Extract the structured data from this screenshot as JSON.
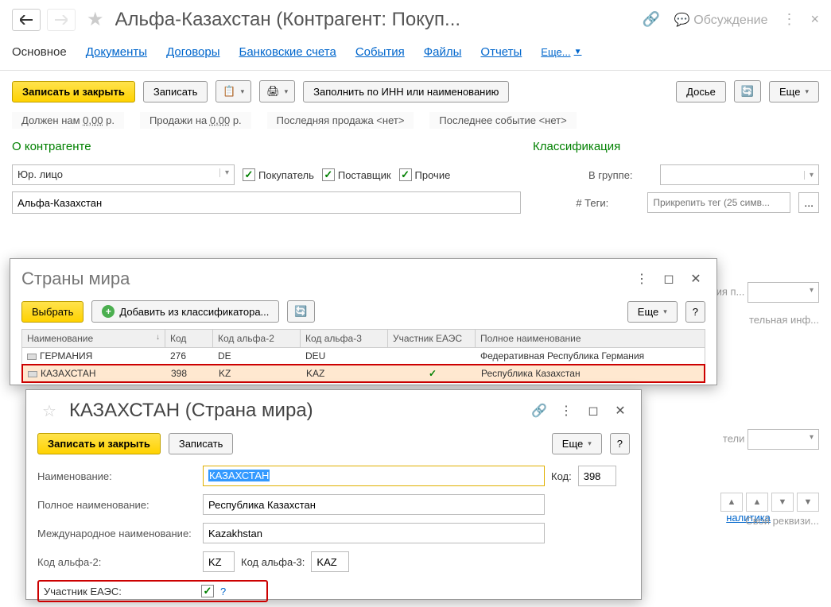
{
  "header": {
    "title": "Альфа-Казахстан (Контрагент: Покуп...",
    "discussion": "Обсуждение"
  },
  "tabs": {
    "main": "Основное",
    "docs": "Документы",
    "contracts": "Договоры",
    "bank": "Банковские счета",
    "events": "События",
    "files": "Файлы",
    "reports": "Отчеты",
    "more": "Еще..."
  },
  "toolbar": {
    "save_close": "Записать и закрыть",
    "save": "Записать",
    "fill_inn": "Заполнить по ИНН или наименованию",
    "dossier": "Досье",
    "more": "Еще"
  },
  "status": {
    "owes_label": "Должен нам",
    "owes_value": "0,00",
    "owes_suffix": "р.",
    "sales_label": "Продажи на",
    "sales_value": "0,00",
    "sales_suffix": "р.",
    "last_sale": "Последняя продажа <нет>",
    "last_event": "Последнее событие <нет>"
  },
  "sections": {
    "about": "О контрагенте",
    "classification": "Классификация"
  },
  "form": {
    "type": "Юр. лицо",
    "buyer": "Покупатель",
    "supplier": "Поставщик",
    "other": "Прочие",
    "name_value": "Альфа-Казахстан",
    "group_label": "В группе:",
    "tags_label": "# Теги:",
    "tags_placeholder": "Прикрепить тег (25 симв..."
  },
  "ghost": {
    "cross1": "ечения п...",
    "cross2": "тельная инф...",
    "cross3": "тели",
    "analytics": "налитика",
    "own_req": "Свой реквизи..."
  },
  "countries_dialog": {
    "title": "Страны мира",
    "select": "Выбрать",
    "add_classifier": "Добавить из классификатора...",
    "more": "Еще",
    "columns": {
      "name": "Наименование",
      "code": "Код",
      "alpha2": "Код альфа-2",
      "alpha3": "Код альфа-3",
      "eaec": "Участник ЕАЭС",
      "full": "Полное наименование"
    },
    "rows": [
      {
        "name": "ГЕРМАНИЯ",
        "code": "276",
        "a2": "DE",
        "a3": "DEU",
        "eaec": "",
        "full": "Федеративная Республика Германия"
      },
      {
        "name": "КАЗАХСТАН",
        "code": "398",
        "a2": "KZ",
        "a3": "KAZ",
        "eaec": "✓",
        "full": "Республика Казахстан"
      }
    ]
  },
  "country_dialog": {
    "title": "КАЗАХСТАН (Страна мира)",
    "save_close": "Записать и закрыть",
    "save": "Записать",
    "more": "Еще",
    "name_label": "Наименование:",
    "name_value": "КАЗАХСТАН",
    "code_label": "Код:",
    "code_value": "398",
    "full_label": "Полное наименование:",
    "full_value": "Республика Казахстан",
    "intl_label": "Международное наименование:",
    "intl_value": "Kazakhstan",
    "alpha2_label": "Код альфа-2:",
    "alpha2_value": "KZ",
    "alpha3_label": "Код альфа-3:",
    "alpha3_value": "KAZ",
    "eaec_label": "Участник ЕАЭС:"
  }
}
